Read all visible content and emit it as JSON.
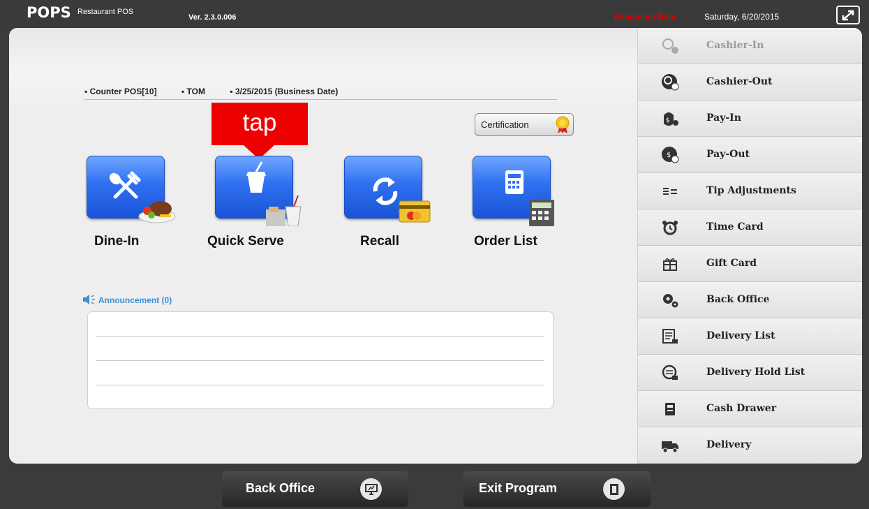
{
  "titlebar": {
    "logo": "POPS",
    "logo_sub": "Restaurant POS",
    "version": "Ver. 2.3.0.006",
    "expiration_label": "Expiration Date",
    "expiration_date": "Saturday, 6/20/2015"
  },
  "info": {
    "station": "Counter POS[10]",
    "user": "TOM",
    "business_date": "3/25/2015 (Business Date)"
  },
  "certification_label": "Certification",
  "annotation": {
    "tap_label": "tap"
  },
  "tiles": [
    {
      "label": "Dine-In",
      "icon": "dine-in-icon"
    },
    {
      "label": "Quick Serve",
      "icon": "quick-serve-icon"
    },
    {
      "label": "Recall",
      "icon": "recall-icon"
    },
    {
      "label": "Order List",
      "icon": "order-list-icon"
    }
  ],
  "announcement": {
    "label": "Announcement (0)"
  },
  "sidebar": {
    "items": [
      {
        "label": "Cashier-In",
        "icon": "cashier-in-icon",
        "enabled": false
      },
      {
        "label": "Cashier-Out",
        "icon": "cashier-out-icon",
        "enabled": true
      },
      {
        "label": "Pay-In",
        "icon": "pay-in-icon",
        "enabled": true
      },
      {
        "label": "Pay-Out",
        "icon": "pay-out-icon",
        "enabled": true
      },
      {
        "label": "Tip Adjustments",
        "icon": "tip-adjustments-icon",
        "enabled": true
      },
      {
        "label": "Time Card",
        "icon": "alarm-clock-icon",
        "enabled": true
      },
      {
        "label": "Gift Card",
        "icon": "gift-icon",
        "enabled": true
      },
      {
        "label": "Back Office",
        "icon": "gears-icon",
        "enabled": true
      },
      {
        "label": "Delivery List",
        "icon": "delivery-list-icon",
        "enabled": true
      },
      {
        "label": "Delivery Hold List",
        "icon": "delivery-hold-icon",
        "enabled": true
      },
      {
        "label": "Cash Drawer",
        "icon": "cash-drawer-icon",
        "enabled": true
      },
      {
        "label": "Delivery",
        "icon": "truck-icon",
        "enabled": true
      }
    ]
  },
  "bottom": {
    "back_office": "Back Office",
    "exit_program": "Exit Program"
  },
  "colors": {
    "tile_blue": "#2f6ff0",
    "annotation_red": "#ee0000",
    "expiration_red": "#e00000",
    "announcement_blue": "#3a8fd8"
  }
}
